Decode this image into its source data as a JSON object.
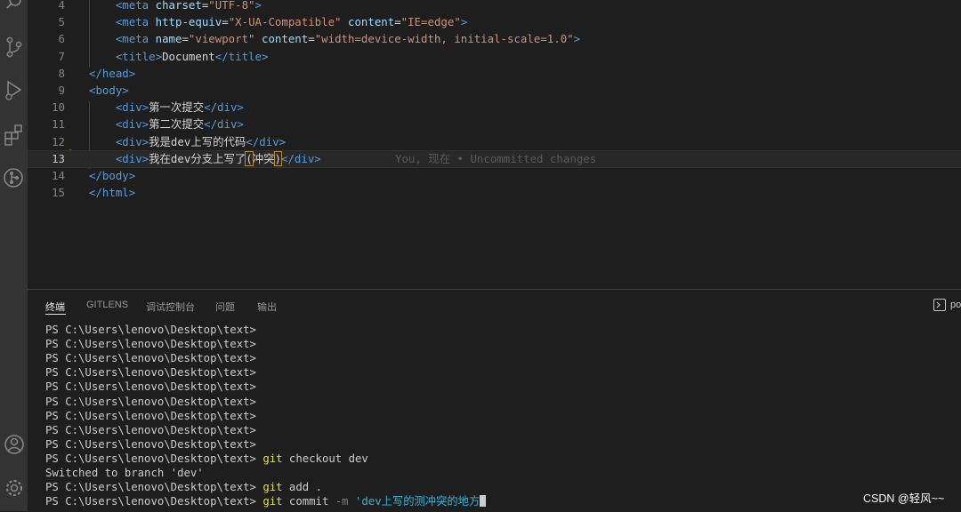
{
  "editor": {
    "lines": [
      {
        "num": "4",
        "code": [
          [
            "p",
            "    "
          ],
          [
            "t",
            "<meta "
          ],
          [
            "a",
            "charset"
          ],
          [
            "d",
            "="
          ],
          [
            "s",
            "\"UTF-8\""
          ],
          [
            "t",
            ">"
          ]
        ]
      },
      {
        "num": "5",
        "code": [
          [
            "p",
            "    "
          ],
          [
            "t",
            "<meta "
          ],
          [
            "a",
            "http-equiv"
          ],
          [
            "d",
            "="
          ],
          [
            "s",
            "\"X-UA-Compatible\""
          ],
          [
            "d",
            " "
          ],
          [
            "a",
            "content"
          ],
          [
            "d",
            "="
          ],
          [
            "s",
            "\"IE=edge\""
          ],
          [
            "t",
            ">"
          ]
        ]
      },
      {
        "num": "6",
        "code": [
          [
            "p",
            "    "
          ],
          [
            "t",
            "<meta "
          ],
          [
            "a",
            "name"
          ],
          [
            "d",
            "="
          ],
          [
            "s",
            "\"viewport\""
          ],
          [
            "d",
            " "
          ],
          [
            "a",
            "content"
          ],
          [
            "d",
            "="
          ],
          [
            "s",
            "\"width=device-width, initial-scale=1.0\""
          ],
          [
            "t",
            ">"
          ]
        ]
      },
      {
        "num": "7",
        "code": [
          [
            "p",
            "    "
          ],
          [
            "t",
            "<title>"
          ],
          [
            "d",
            "Document"
          ],
          [
            "t",
            "</title>"
          ]
        ]
      },
      {
        "num": "8",
        "code": [
          [
            "t",
            "</head>"
          ]
        ]
      },
      {
        "num": "9",
        "code": [
          [
            "t",
            "<body>"
          ]
        ]
      },
      {
        "num": "10",
        "code": [
          [
            "p",
            "    "
          ],
          [
            "t",
            "<div>"
          ],
          [
            "d",
            "第一次提交"
          ],
          [
            "t",
            "</div>"
          ]
        ]
      },
      {
        "num": "11",
        "code": [
          [
            "p",
            "    "
          ],
          [
            "t",
            "<div>"
          ],
          [
            "d",
            "第二次提交"
          ],
          [
            "t",
            "</div>"
          ]
        ]
      },
      {
        "num": "12",
        "code": [
          [
            "p",
            "    "
          ],
          [
            "t",
            "<div>"
          ],
          [
            "d",
            "我是dev上写的代码"
          ],
          [
            "t",
            "</div>"
          ]
        ]
      },
      {
        "num": "13",
        "code": [
          [
            "p",
            "    "
          ],
          [
            "t",
            "<div>"
          ],
          [
            "d",
            "我在dev分支上写了"
          ],
          [
            "b",
            "("
          ],
          [
            "d",
            "冲突"
          ],
          [
            "b",
            ")"
          ],
          [
            "t",
            "</div>"
          ]
        ],
        "current": true,
        "blame": "You, 现在 • Uncommitted changes"
      },
      {
        "num": "14",
        "code": [
          [
            "t",
            "</body>"
          ]
        ]
      },
      {
        "num": "15",
        "code": [
          [
            "t",
            "</html>"
          ]
        ]
      }
    ]
  },
  "panel": {
    "tabs": [
      {
        "label": "终端",
        "active": true
      },
      {
        "label": "GITLENS",
        "active": false
      },
      {
        "label": "调试控制台",
        "active": false
      },
      {
        "label": "问题",
        "active": false
      },
      {
        "label": "输出",
        "active": false
      }
    ],
    "terminal_selector_label": "po",
    "terminal": {
      "prompt": "PS C:\\Users\\lenovo\\Desktop\\text>",
      "empty_prompt_count": 9,
      "commands": [
        {
          "cmd": "git",
          "rest": " checkout dev"
        },
        {
          "output": "Switched to branch 'dev'"
        },
        {
          "cmd": "git",
          "rest": " add ."
        },
        {
          "cmd": "git",
          "rest": " commit ",
          "flag": "-m",
          "string": " 'dev上写的测冲突的地方",
          "cursor": true
        }
      ]
    }
  },
  "activity_icons": [
    "search-icon",
    "source-control-icon",
    "run-debug-icon",
    "extensions-icon",
    "gitlens-icon",
    "account-icon",
    "settings-gear-icon"
  ],
  "watermark": "CSDN @轻风~~"
}
